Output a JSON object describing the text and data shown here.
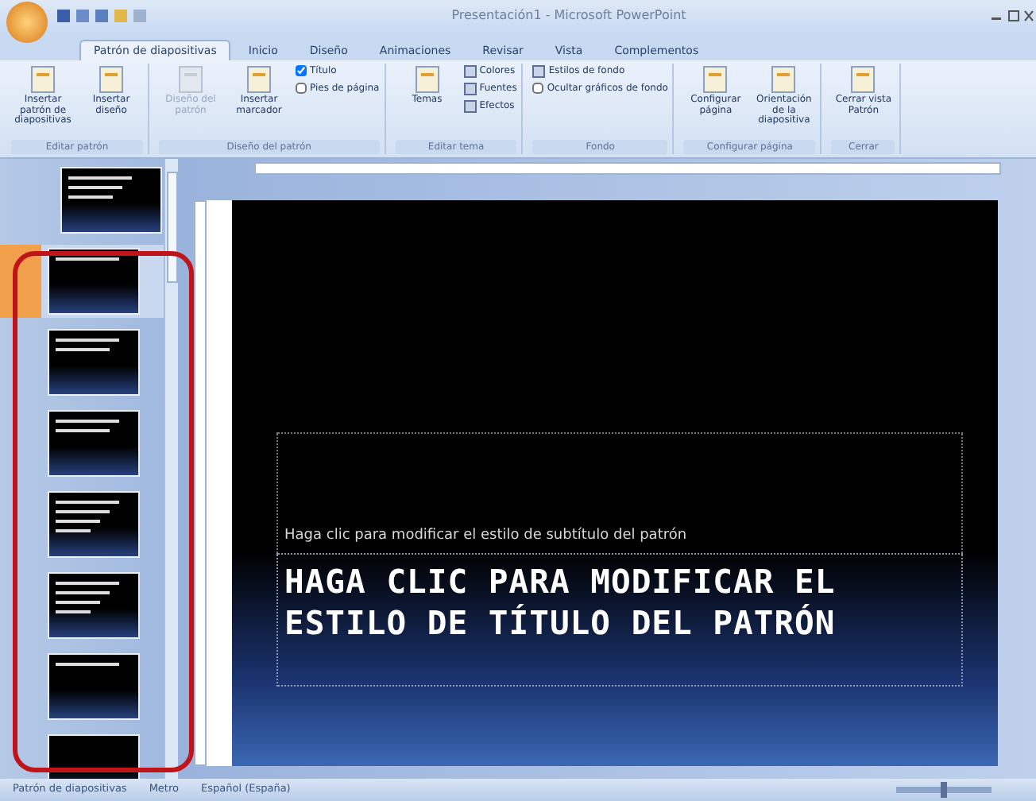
{
  "window": {
    "title": "Presentación1 - Microsoft PowerPoint"
  },
  "tabs": [
    {
      "label": "Patrón de diapositivas",
      "selected": true
    },
    {
      "label": "Inicio",
      "selected": false
    },
    {
      "label": "Diseño",
      "selected": false
    },
    {
      "label": "Animaciones",
      "selected": false
    },
    {
      "label": "Revisar",
      "selected": false
    },
    {
      "label": "Vista",
      "selected": false
    },
    {
      "label": "Complementos",
      "selected": false
    }
  ],
  "ribbon_groups": [
    {
      "name": "Editar patrón",
      "items": [
        {
          "kind": "large",
          "label": "Insertar patrón de diapositivas",
          "disabled": false
        },
        {
          "kind": "large",
          "label": "Insertar diseño",
          "disabled": false
        }
      ]
    },
    {
      "name": "Diseño del patrón",
      "items": [
        {
          "kind": "large",
          "label": "Diseño del patrón",
          "disabled": true
        },
        {
          "kind": "large",
          "label": "Insertar marcador",
          "disabled": false
        },
        {
          "kind": "check",
          "label": "Título",
          "checked": true
        },
        {
          "kind": "check",
          "label": "Pies de página",
          "checked": false
        }
      ]
    },
    {
      "name": "Editar tema",
      "items": [
        {
          "kind": "large",
          "label": "Temas",
          "disabled": false
        },
        {
          "kind": "small",
          "label": "Colores"
        },
        {
          "kind": "small",
          "label": "Fuentes"
        },
        {
          "kind": "small",
          "label": "Efectos"
        }
      ]
    },
    {
      "name": "Fondo",
      "items": [
        {
          "kind": "small",
          "label": "Estilos de fondo"
        },
        {
          "kind": "check",
          "label": "Ocultar gráficos de fondo",
          "checked": false
        }
      ]
    },
    {
      "name": "Configurar página",
      "items": [
        {
          "kind": "large",
          "label": "Configurar página",
          "disabled": false
        },
        {
          "kind": "large",
          "label": "Orientación de la diapositiva",
          "disabled": false
        }
      ]
    },
    {
      "name": "Cerrar",
      "items": [
        {
          "kind": "large",
          "label": "Cerrar vista Patrón",
          "disabled": false
        }
      ]
    }
  ],
  "thumbnails": [
    {
      "kind": "master",
      "selected": false
    },
    {
      "kind": "title",
      "selected": true
    },
    {
      "kind": "content",
      "selected": false
    },
    {
      "kind": "section",
      "selected": false
    },
    {
      "kind": "two",
      "selected": false
    },
    {
      "kind": "two",
      "selected": false
    },
    {
      "kind": "titleonly",
      "selected": false
    },
    {
      "kind": "blank",
      "selected": false
    }
  ],
  "slide": {
    "subtitle": "Haga clic para modificar el estilo de subtítulo del patrón",
    "title": "HAGA CLIC PARA MODIFICAR EL ESTILO DE TÍTULO DEL PATRÓN"
  },
  "status_bar": {
    "view": "Patrón de diapositivas",
    "theme": "Metro",
    "language": "Español (España)",
    "zoom": {
      "level": 0.5
    }
  }
}
